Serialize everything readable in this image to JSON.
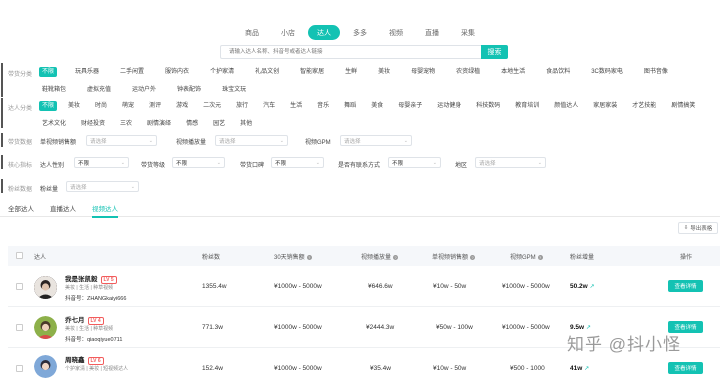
{
  "nav": {
    "tabs": [
      "商品",
      "小店",
      "达人",
      "多多",
      "视频",
      "直播",
      "采集"
    ],
    "active_index": 2
  },
  "search": {
    "placeholder": "请输入达人名称、抖音号或者达人链接",
    "button": "搜索"
  },
  "filters": {
    "category": {
      "label": "带货分类",
      "items": [
        "不限",
        "玩具乐器",
        "二手闲置",
        "服饰内衣",
        "个护家清",
        "礼品文创",
        "智能家居",
        "生鲜",
        "美妆",
        "母婴宠物",
        "农资绿植",
        "本地生活",
        "食品饮料",
        "3C数码家电",
        "图书音像",
        "鞋靴箱包",
        "虚拟充值",
        "运动户外",
        "钟表配饰",
        "珠宝文玩"
      ]
    },
    "type": {
      "label": "达人分类",
      "items": [
        "不限",
        "美妆",
        "时尚",
        "萌宠",
        "测评",
        "游戏",
        "二次元",
        "旅行",
        "汽车",
        "生活",
        "音乐",
        "舞蹈",
        "美食",
        "母婴亲子",
        "运动健身",
        "科技数码",
        "教育培训",
        "颜值达人",
        "家居家装",
        "才艺技能",
        "剧情搞笑",
        "艺术文化",
        "财经投资",
        "三农",
        "剧情演绎",
        "情感",
        "园艺",
        "其他"
      ]
    },
    "sales": {
      "label": "带货数据",
      "items": [
        {
          "label": "单视频销售额",
          "placeholder": "请选择"
        },
        {
          "label": "视频播放量",
          "placeholder": "请选择"
        },
        {
          "label": "视频GPM",
          "placeholder": "请选择"
        }
      ]
    },
    "core": {
      "label": "核心指标",
      "items": [
        {
          "label": "达人性别",
          "value": "不限"
        },
        {
          "label": "带货等级",
          "value": "不限"
        },
        {
          "label": "带货口碑",
          "value": "不限"
        },
        {
          "label": "是否有联系方式",
          "value": "不限"
        },
        {
          "label": "地区",
          "placeholder": "请选择"
        }
      ]
    },
    "fans": {
      "label": "粉丝数据",
      "items": [
        {
          "label": "粉丝量",
          "placeholder": "请选择"
        }
      ]
    }
  },
  "subtabs": {
    "items": [
      "全部达人",
      "直播达人",
      "视频达人"
    ],
    "active_index": 2
  },
  "export_label": "导出表格",
  "table": {
    "headers": [
      "达人",
      "粉丝数",
      "30天销售额",
      "视频播放量",
      "单视频销售额",
      "视频GPM",
      "粉丝增量",
      "操作"
    ],
    "rows": [
      {
        "name": "我是张凯毅",
        "level": "LV 5",
        "tags": "美妆 | 生活 | 种草视频",
        "douyin": "抖音号：ZHANGkaiyi666",
        "fans": "1355.4w",
        "sales30": "¥1000w - 5000w",
        "plays": "¥646.6w",
        "single": "¥10w - 50w",
        "gpm": "¥1000w - 5000w",
        "growth": "50.2w",
        "action": "查看详情"
      },
      {
        "name": "乔七月",
        "level": "LV 4",
        "tags": "美妆 | 生活 | 种草视频",
        "douyin": "抖音号：qiaoqiyue0711",
        "fans": "771.3w",
        "sales30": "¥1000w - 5000w",
        "plays": "¥2444.3w",
        "single": "¥50w - 100w",
        "gpm": "¥1000w - 5000w",
        "growth": "9.5w",
        "action": "查看详情"
      },
      {
        "name": "周晓鑫",
        "level": "LV 6",
        "tags": "个护家清 | 美妆 | 短视频达人",
        "douyin": "",
        "fans": "152.4w",
        "sales30": "¥1000w - 5000w",
        "plays": "¥35.4w",
        "single": "¥10w - 50w",
        "gpm": "¥500 - 1000",
        "growth": "41w",
        "action": "查看详情"
      }
    ]
  },
  "watermark": "知乎 @抖小怪",
  "colors": {
    "accent": "#13c2b3",
    "level": "#f25c5c"
  }
}
